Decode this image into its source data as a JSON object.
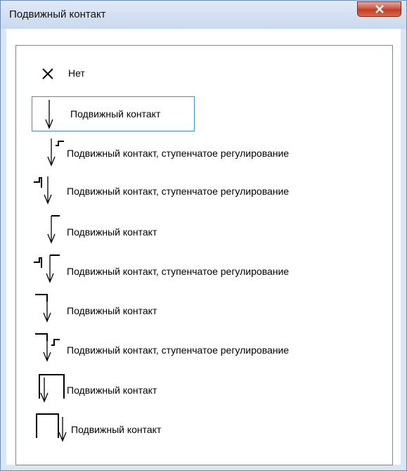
{
  "window": {
    "title": "Подвижный контакт",
    "close_icon": "close-icon"
  },
  "list": {
    "items": [
      {
        "icon": "none-x-icon",
        "label": "Нет"
      },
      {
        "icon": "moving-contact-arrow-icon",
        "label": "Подвижный контакт",
        "selected": true
      },
      {
        "icon": "moving-contact-step-right-icon",
        "label": "Подвижный контакт, ступенчатое регулирование"
      },
      {
        "icon": "moving-contact-step-left-icon",
        "label": "Подвижный контакт, ступенчатое регулирование"
      },
      {
        "icon": "moving-contact-right-hook-icon",
        "label": "Подвижный контакт"
      },
      {
        "icon": "moving-contact-right-hook-step-icon",
        "label": "Подвижный контакт, ступенчатое регулирование"
      },
      {
        "icon": "moving-contact-left-hook-icon",
        "label": "Подвижный контакт"
      },
      {
        "icon": "moving-contact-left-hook-step-icon",
        "label": "Подвижный контакт, ступенчатое регулирование"
      },
      {
        "icon": "moving-contact-bracket-right-icon",
        "label": "Подвижный контакт"
      },
      {
        "icon": "moving-contact-bracket-left-icon",
        "label": "Подвижный контакт"
      }
    ]
  }
}
